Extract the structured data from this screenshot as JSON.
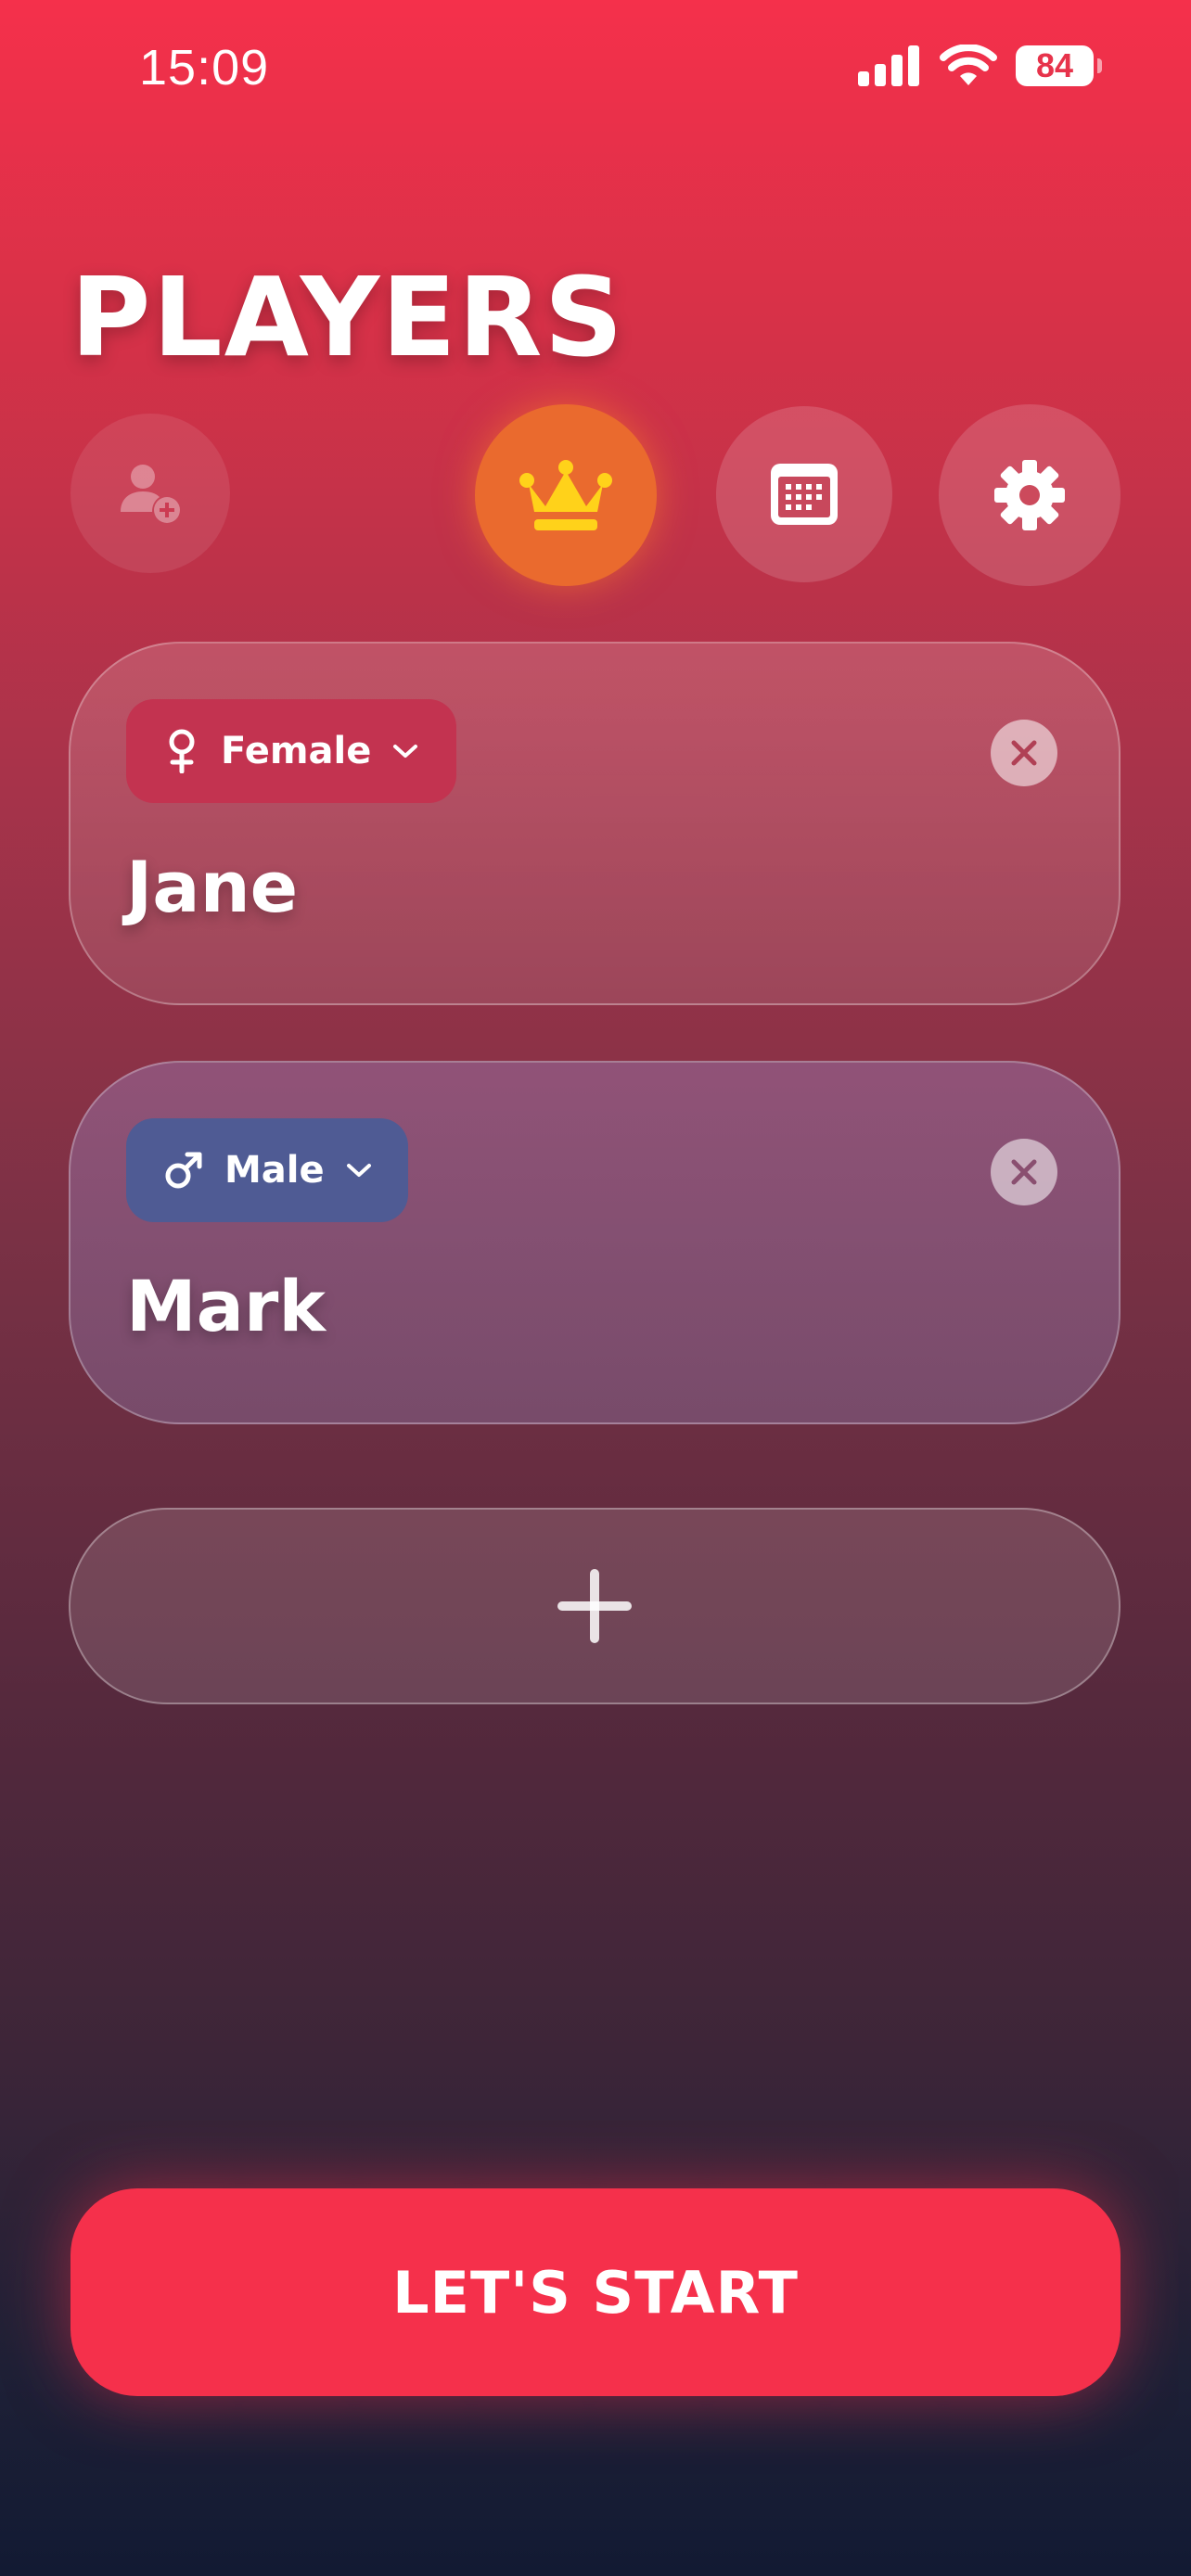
{
  "status_bar": {
    "time": "15:09",
    "battery": "84",
    "icons": [
      "signal-icon",
      "wifi-icon",
      "battery-icon"
    ]
  },
  "header": {
    "title": "PLAYERS"
  },
  "toolbar": {
    "buttons": [
      {
        "name": "add-player",
        "icon": "user-plus-icon"
      },
      {
        "name": "premium",
        "icon": "crown-icon"
      },
      {
        "name": "calendar",
        "icon": "calendar-icon"
      },
      {
        "name": "settings",
        "icon": "gear-icon"
      }
    ]
  },
  "players": [
    {
      "gender": "Female",
      "gender_icon": "female-symbol-icon",
      "name": "Jane"
    },
    {
      "gender": "Male",
      "gender_icon": "male-symbol-icon",
      "name": "Mark"
    }
  ],
  "add_player": {
    "icon": "plus-icon"
  },
  "actions": {
    "start_label": "LET'S START"
  },
  "colors": {
    "accent": "#f5304b",
    "crown": "#ffd21a",
    "crown_bg": "#ea6a2e",
    "female_chip": "#c33350",
    "male_chip": "#4f5b94"
  }
}
